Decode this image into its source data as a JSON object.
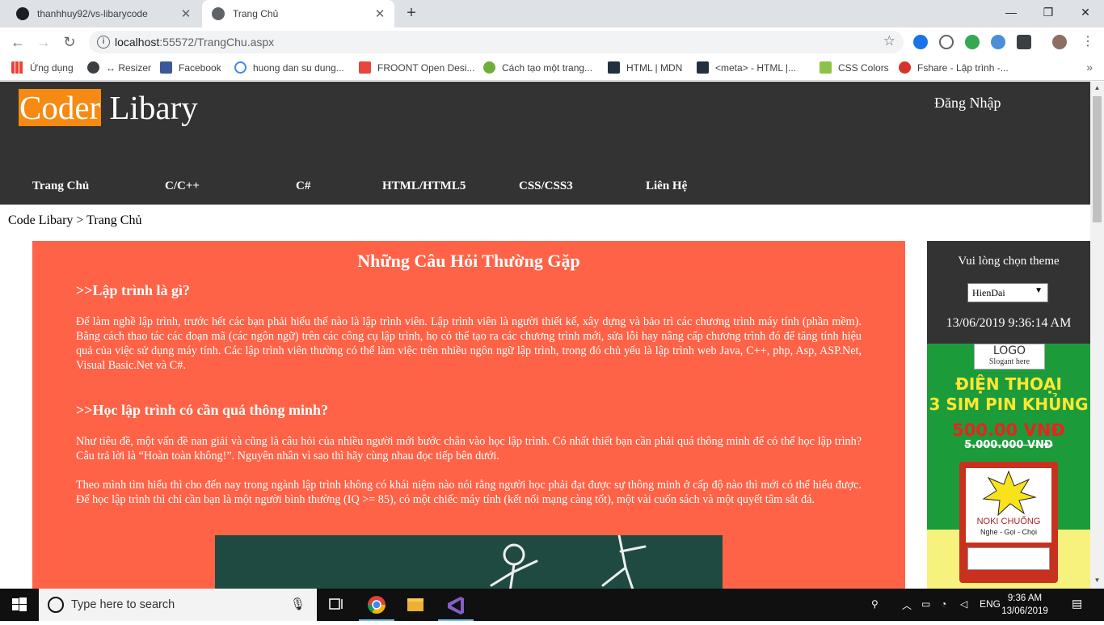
{
  "browser": {
    "tabs": [
      {
        "title": "thanhhuy92/vs-libarycode",
        "active": false
      },
      {
        "title": "Trang Chủ",
        "active": true
      }
    ],
    "url_host": "localhost",
    "url_rest": ":55572/TrangChu.aspx",
    "bookmarks": [
      {
        "label": "Ứng dụng",
        "icon": "apps-grid-icon"
      },
      {
        "label": "↔ Resizer",
        "icon": "resizer-icon"
      },
      {
        "label": "Facebook",
        "icon": "facebook-icon"
      },
      {
        "label": "huong dan su dung...",
        "icon": "google-icon"
      },
      {
        "label": "FROONT Open Desi...",
        "icon": "froont-icon"
      },
      {
        "label": "Cách tạo một trang...",
        "icon": "wordpress-icon"
      },
      {
        "label": "HTML | MDN",
        "icon": "mdn-icon"
      },
      {
        "label": "<meta> - HTML |...",
        "icon": "mdn-icon"
      },
      {
        "label": "CSS Colors",
        "icon": "w3schools-icon"
      },
      {
        "label": "Fshare - Lập trình -...",
        "icon": "fshare-icon"
      }
    ]
  },
  "site": {
    "logo_highlight": "Coder",
    "logo_rest": " Libary",
    "login": "Đăng Nhập",
    "menu": [
      "Trang Chủ",
      "C/C++",
      "C#",
      "HTML/HTML5",
      "CSS/CSS3",
      "Liên Hệ"
    ],
    "breadcrumb": "Code Libary > Trang Chủ"
  },
  "content": {
    "heading": "Những Câu Hỏi Thường Gặp",
    "q1": ">>Lập trình là gì?",
    "p1": "Để làm nghề lập trình, trước hết các bạn phải hiểu thế nào là lập trình viên. Lập trình viên là người thiết kế, xây dựng và bảo trì các chương trình máy tính (phần mềm). Bằng cách thao tác các đoạn mã (các ngôn ngữ) trên các công cụ lập trình, họ có thể tạo ra các chương trình mới, sửa lỗi hay nâng cấp chương trình đó để tăng tính hiệu quả của việc sử dụng máy tính. Các lập trình viên thường có thể làm việc trên nhiều ngôn ngữ lập trình, trong đó chủ yếu là lập trình web Java, C++, php, Asp, ASP.Net, Visual Basic.Net và C#.",
    "q2": ">>Học lập trình có cần quá thông minh?",
    "p2": "Như tiêu đề, một vấn đề nan giải và cũng là câu hỏi của nhiều người mới bước chân vào học lập trình. Có nhất thiết bạn cần phải quá thông minh để có thể học lập trình? Câu trả lời là “Hoàn toàn không!”. Nguyên nhân vì sao thì hãy cùng nhau đọc tiếp bên dưới.",
    "p3": "Theo mình tìm hiểu thì cho đến nay trong ngành lập trình không có khái niệm nào nói rằng người học phải đạt được sự thông minh ở cấp độ nào thì mới có thể hiểu được. Để học lập trình thì chỉ cần bạn là một người bình thường (IQ >= 85), có một chiếc máy tính (kết nối mạng càng tốt), một vài cuốn sách và một quyết tâm sắt đá."
  },
  "sidebar": {
    "theme_label": "Vui lòng chọn theme",
    "theme_selected": "HienDai",
    "datetime": "13/06/2019 9:36:14 AM",
    "ad": {
      "logo": "LOGO",
      "slogan": "Slogant here",
      "line1": "ĐIỆN THOẠI",
      "line2": "3 SIM PIN KHỦNG",
      "price": "500.00 VNĐ",
      "old_price": "5.000.000 VNĐ",
      "brand": "NOKI CHUỐNG",
      "tagline": "Nghe - Gọi - Chọi"
    }
  },
  "taskbar": {
    "search_placeholder": "Type here to search",
    "lang": "ENG",
    "time": "9:36 AM",
    "date": "13/06/2019"
  },
  "colors": {
    "header_bg": "#333333",
    "logo_highlight": "#f68a12",
    "content_bg": "#ff6347",
    "ad_green": "#1c9b3b"
  }
}
